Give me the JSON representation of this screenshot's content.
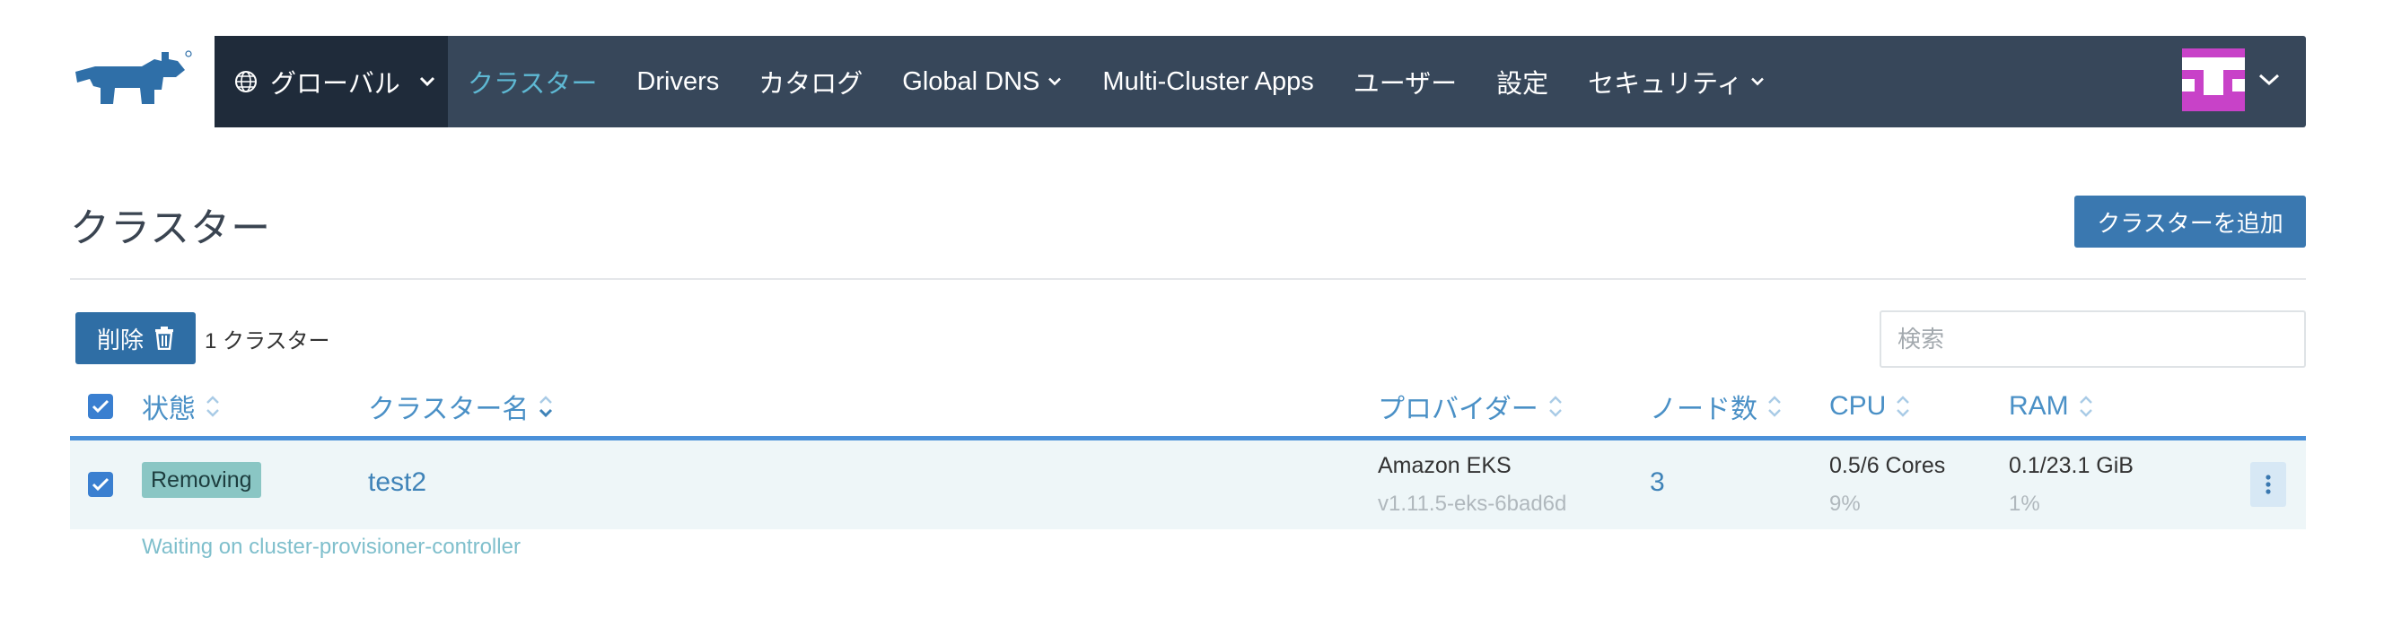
{
  "nav": {
    "scope_label": "グローバル",
    "items": [
      {
        "label": "クラスター",
        "active": true,
        "has_chevron": false
      },
      {
        "label": "Drivers",
        "active": false,
        "has_chevron": false
      },
      {
        "label": "カタログ",
        "active": false,
        "has_chevron": false
      },
      {
        "label": "Global DNS",
        "active": false,
        "has_chevron": true
      },
      {
        "label": "Multi-Cluster Apps",
        "active": false,
        "has_chevron": false
      },
      {
        "label": "ユーザー",
        "active": false,
        "has_chevron": false
      },
      {
        "label": "設定",
        "active": false,
        "has_chevron": false
      },
      {
        "label": "セキュリティ",
        "active": false,
        "has_chevron": true
      }
    ],
    "colors": {
      "bar": "#37475a",
      "scope_bg": "#1f2b3a",
      "active": "#5eb8d3",
      "avatar": "#c842c8"
    },
    "icons": [
      "globe-icon",
      "chevron-down-icon",
      "avatar-icon"
    ]
  },
  "page": {
    "title": "クラスター",
    "add_button": "クラスターを追加"
  },
  "toolbar": {
    "delete_label": "削除",
    "count_text": "1 クラスター",
    "search_placeholder": "検索"
  },
  "table": {
    "headers": {
      "state": "状態",
      "name": "クラスター名",
      "provider": "プロバイダー",
      "nodes": "ノード数",
      "cpu": "CPU",
      "ram": "RAM"
    },
    "rows": [
      {
        "checked": true,
        "state": "Removing",
        "name": "test2",
        "provider": "Amazon EKS",
        "provider_version": "v1.11.5-eks-6bad6d",
        "nodes": "3",
        "cpu": "0.5/6 Cores",
        "cpu_pct": "9%",
        "ram": "0.1/23.1 GiB",
        "ram_pct": "1%",
        "message": "Waiting on cluster-provisioner-controller"
      }
    ]
  }
}
